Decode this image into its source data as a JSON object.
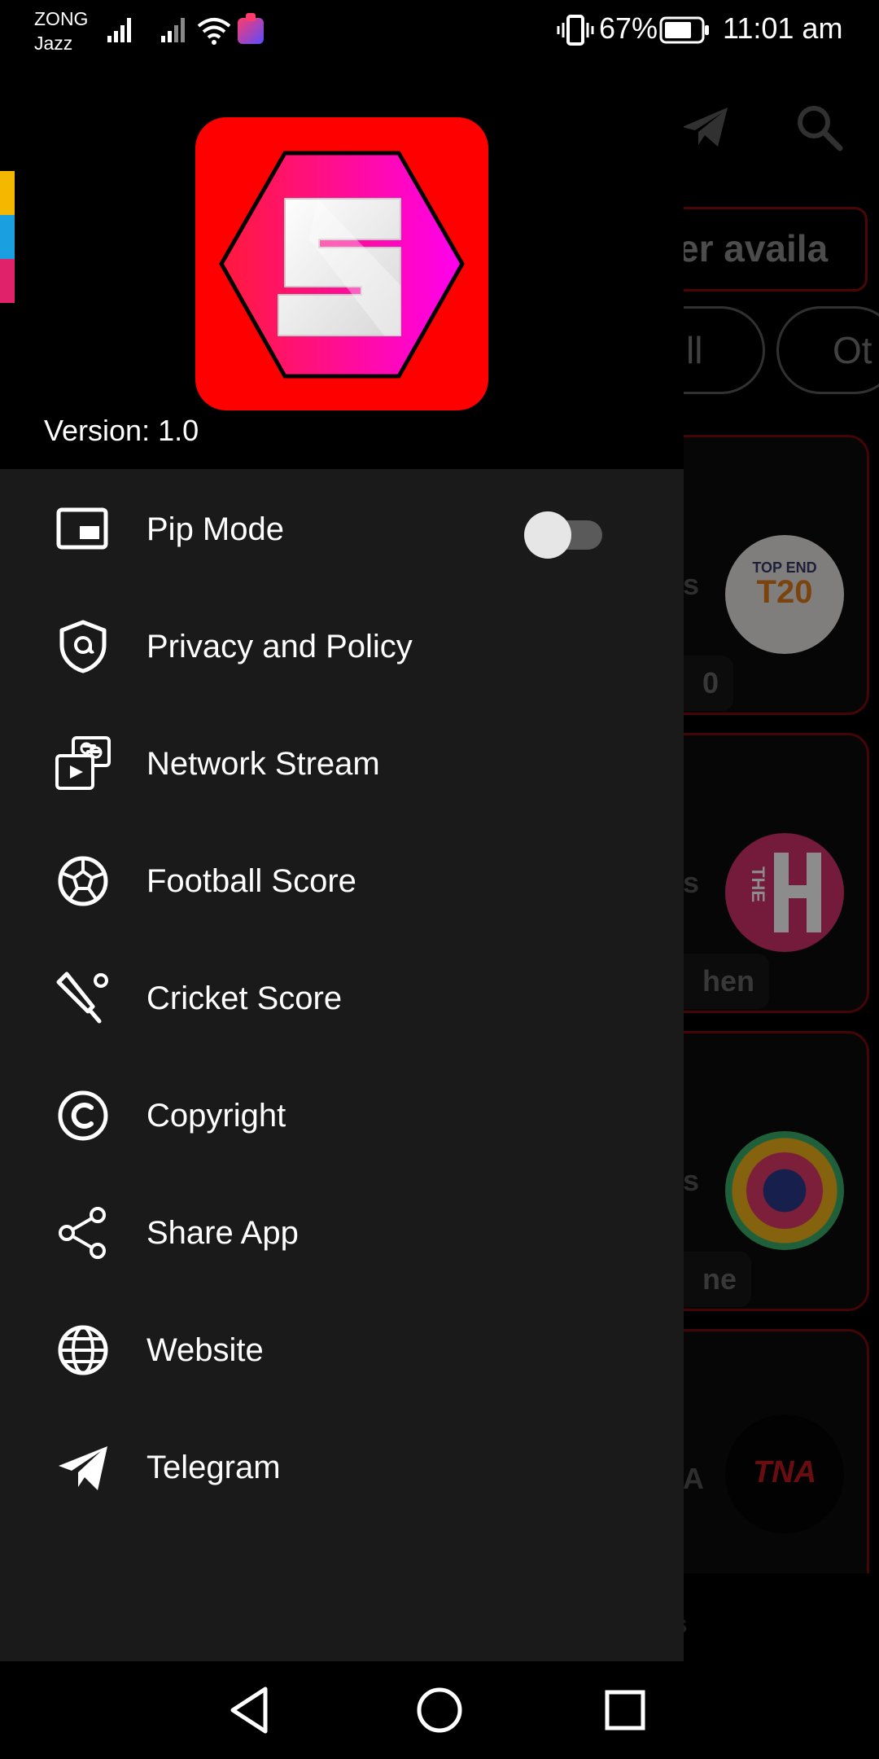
{
  "status_bar": {
    "carrier_line1": "ZONG",
    "carrier_line2": "Jazz",
    "battery_percent": "67%",
    "time": "11:01 am"
  },
  "background": {
    "banner_text": "er availa",
    "chip_1": "ll",
    "chip_2": "Ot",
    "cards": [
      {
        "side_text": "s",
        "tag": "0"
      },
      {
        "side_text": "s",
        "tag": "hen"
      },
      {
        "side_text": "s",
        "tag": "ne"
      },
      {
        "side_text": "A",
        "tag": ""
      }
    ],
    "card_logo_1_line1": "TOP END",
    "card_logo_1_line2": "T20",
    "card_logo_2": "THE",
    "card_logo_4": "TNA",
    "bottom_text": "ies"
  },
  "drawer": {
    "version": "Version: 1.0",
    "pip_toggle_on": false,
    "items": [
      {
        "label": "Pip Mode",
        "icon": "picture-in-picture-icon"
      },
      {
        "label": "Privacy and Policy",
        "icon": "shield-icon"
      },
      {
        "label": "Network Stream",
        "icon": "network-stream-icon"
      },
      {
        "label": "Football Score",
        "icon": "football-icon"
      },
      {
        "label": "Cricket Score",
        "icon": "cricket-bat-icon"
      },
      {
        "label": "Copyright",
        "icon": "copyright-icon"
      },
      {
        "label": "Share App",
        "icon": "share-icon"
      },
      {
        "label": "Website",
        "icon": "globe-icon"
      },
      {
        "label": "Telegram",
        "icon": "telegram-icon"
      }
    ]
  },
  "colors": {
    "accent_red": "#ff0000",
    "logo_magenta": "#ff00cc",
    "drawer_bg": "#1a1a1a"
  }
}
